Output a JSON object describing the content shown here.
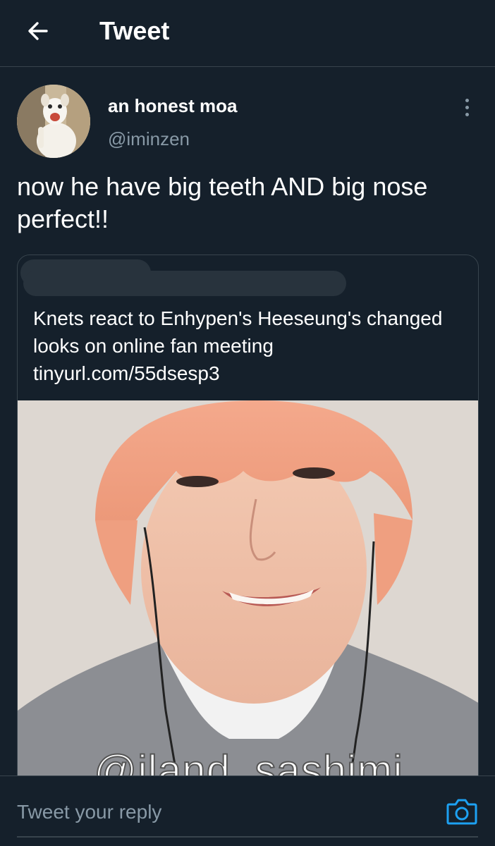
{
  "header": {
    "title": "Tweet",
    "back_icon": "arrow-left-icon"
  },
  "tweet": {
    "author_name": "an honest moa",
    "author_handle": "@iminzen",
    "text": "now he have big teeth AND big nose perfect!!",
    "more_icon": "more-vertical-icon"
  },
  "card": {
    "title": "Knets react to Enhypen's Heeseung's changed looks on online fan meeting",
    "url": "tinyurl.com/55dsesp3",
    "image_watermark": "@iland_sashimi"
  },
  "reply": {
    "placeholder": "Tweet your reply",
    "camera_icon": "camera-icon"
  },
  "colors": {
    "background": "#15202b",
    "border": "#38444d",
    "secondary_text": "#8899a6",
    "accent": "#1da1f2"
  }
}
